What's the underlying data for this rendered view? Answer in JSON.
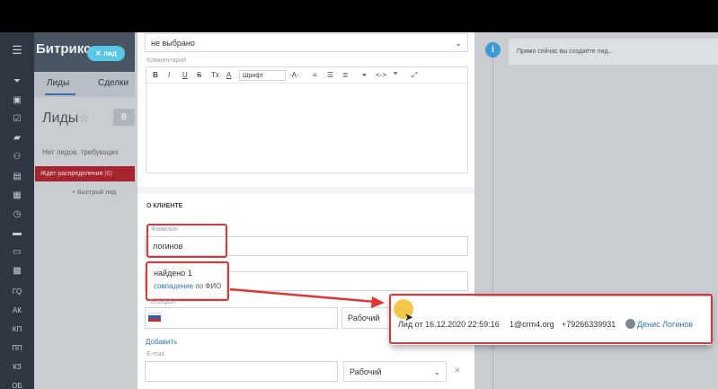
{
  "sidebar": {
    "icons": [
      "filter-icon",
      "inbox-icon",
      "task-icon",
      "chat-icon",
      "contacts-icon",
      "shop-icon",
      "calendar-icon",
      "clock-icon",
      "car-icon",
      "window-icon",
      "dashboard-icon"
    ],
    "labels": [
      "ГQ",
      "АК",
      "КП",
      "ПП",
      "КЗ",
      "ОБ"
    ]
  },
  "header": {
    "brand": "Битрикс",
    "pill_label": "✕ лид"
  },
  "tabs": [
    "Лиды",
    "Сделки"
  ],
  "page": {
    "title": "Лиды",
    "no_leads": "Нет лидов, требующих",
    "stage_label": "Ждет распределения",
    "stage_count": "(0)",
    "quick_add": "+ Быстрый лид"
  },
  "form": {
    "top_select_value": "не выбрано",
    "comment_label": "Комментарий",
    "toolbar": [
      "B",
      "I",
      "U",
      "S",
      "Tx",
      "A",
      "Шрифт",
      "·A·",
      "≡",
      "☰",
      "≣",
      "⚭",
      "<->",
      "❞",
      "⤢"
    ],
    "section_title": "О КЛИЕНТЕ",
    "surname_label": "Фамилия",
    "surname_value": "логинов",
    "found_text": "найдено 1",
    "match_link": "совпадение",
    "match_suffix": "по ФИО",
    "phone_label": "Телефон",
    "phone_type": "Рабочий",
    "add_label": "Добавить",
    "email_label": "E-mail",
    "email_type": "Рабочий"
  },
  "hint": {
    "text": "Прямо сейчас вы создаёте лид..."
  },
  "result": {
    "lead_text": "Лид от 16.12.2020 22:59:16",
    "email": "1@crm4.org",
    "phone": "+79266339931",
    "person": "Денис Логинов"
  },
  "colors": {
    "highlight": "#e23434",
    "link": "#2f73b7",
    "stage": "#a6242d",
    "pill": "#59c8e7"
  }
}
